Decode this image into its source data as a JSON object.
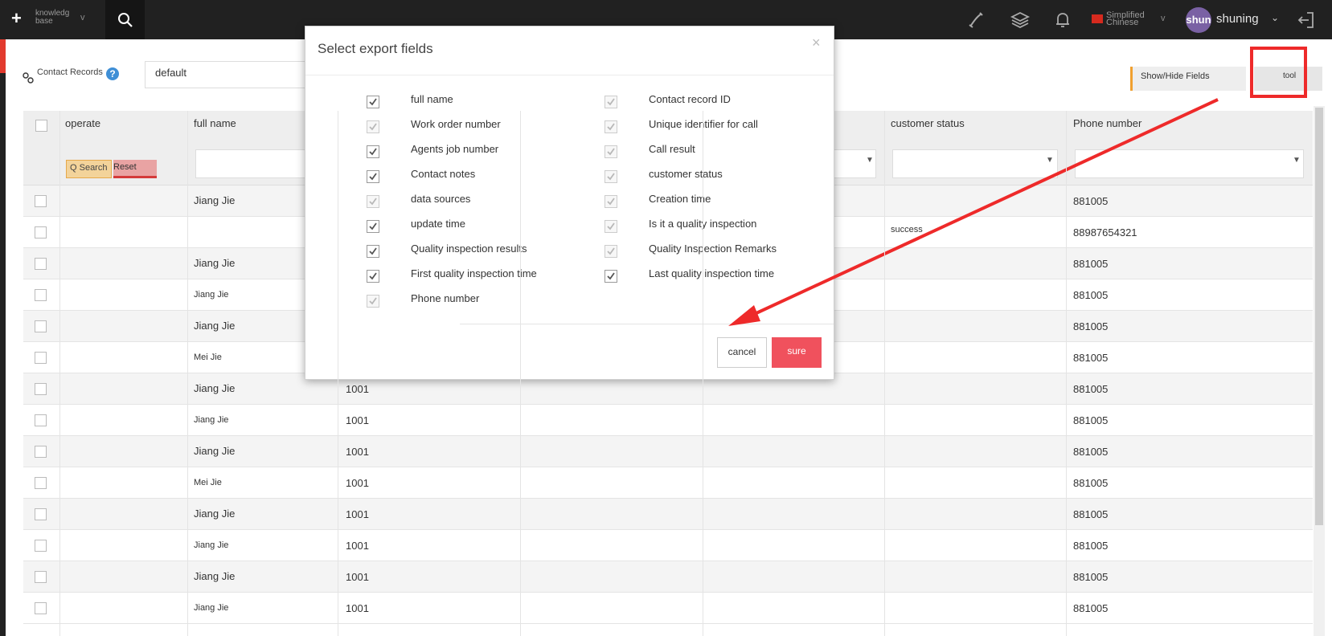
{
  "topbar": {
    "knowledge_base": "knowledg base",
    "language": "Simplified Chinese",
    "avatar_text": "shun",
    "username": "shuning"
  },
  "toolbar": {
    "contact_records_label": "Contact Records",
    "view_select_value": "default",
    "show_hide_fields": "Show/Hide Fields",
    "tool": "tool"
  },
  "table": {
    "headers": {
      "operate": "operate",
      "full_name": "full name",
      "customer_status": "customer status",
      "phone_number": "Phone number"
    },
    "quick_search": "Q Search",
    "reset": "Reset",
    "rows": [
      {
        "name": "Jiang Jie",
        "job": "",
        "status": "",
        "phone": "881005"
      },
      {
        "name": "",
        "job": "",
        "status": "success",
        "phone": "88987654321"
      },
      {
        "name": "Jiang Jie",
        "job": "",
        "status": "",
        "phone": "881005"
      },
      {
        "name": "Jiang Jie",
        "job": "",
        "status": "",
        "phone": "881005"
      },
      {
        "name": "Jiang Jie",
        "job": "",
        "status": "",
        "phone": "881005"
      },
      {
        "name": "Mei Jie",
        "job": "",
        "status": "",
        "phone": "881005"
      },
      {
        "name": "Jiang Jie",
        "job": "1001",
        "status": "",
        "phone": "881005"
      },
      {
        "name": "Jiang Jie",
        "job": "1001",
        "status": "",
        "phone": "881005"
      },
      {
        "name": "Jiang Jie",
        "job": "1001",
        "status": "",
        "phone": "881005"
      },
      {
        "name": "Mei Jie",
        "job": "1001",
        "status": "",
        "phone": "881005"
      },
      {
        "name": "Jiang Jie",
        "job": "1001",
        "status": "",
        "phone": "881005"
      },
      {
        "name": "Jiang Jie",
        "job": "1001",
        "status": "",
        "phone": "881005"
      },
      {
        "name": "Jiang Jie",
        "job": "1001",
        "status": "",
        "phone": "881005"
      },
      {
        "name": "Jiang Jie",
        "job": "1001",
        "status": "",
        "phone": "881005"
      }
    ]
  },
  "modal": {
    "title": "Select export fields",
    "close": "×",
    "fields_left": [
      {
        "label": "full name",
        "checked": true,
        "disabled": false
      },
      {
        "label": "Work order number",
        "checked": true,
        "disabled": true
      },
      {
        "label": "Agents job number",
        "checked": true,
        "disabled": false
      },
      {
        "label": "Contact notes",
        "checked": true,
        "disabled": false
      },
      {
        "label": "data sources",
        "checked": true,
        "disabled": true
      },
      {
        "label": "update time",
        "checked": true,
        "disabled": false
      },
      {
        "label": "Quality inspection results",
        "checked": true,
        "disabled": false
      },
      {
        "label": "First quality inspection time",
        "checked": true,
        "disabled": false
      },
      {
        "label": "Phone number",
        "checked": true,
        "disabled": true
      }
    ],
    "fields_right": [
      {
        "label": "Contact record ID",
        "checked": true,
        "disabled": true
      },
      {
        "label": "Unique identifier for call",
        "checked": true,
        "disabled": true
      },
      {
        "label": "Call result",
        "checked": true,
        "disabled": true
      },
      {
        "label": "customer status",
        "checked": true,
        "disabled": true
      },
      {
        "label": "Creation time",
        "checked": true,
        "disabled": true
      },
      {
        "label": "Is it a quality inspection",
        "checked": true,
        "disabled": true
      },
      {
        "label": "Quality Inspection Remarks",
        "checked": true,
        "disabled": true
      },
      {
        "label": "Last quality inspection time",
        "checked": true,
        "disabled": false
      }
    ],
    "cancel": "cancel",
    "sure": "sure"
  },
  "colors": {
    "topbar": "#212121",
    "sure_button": "#f0515d",
    "annotation_red": "#ee2a2a"
  }
}
